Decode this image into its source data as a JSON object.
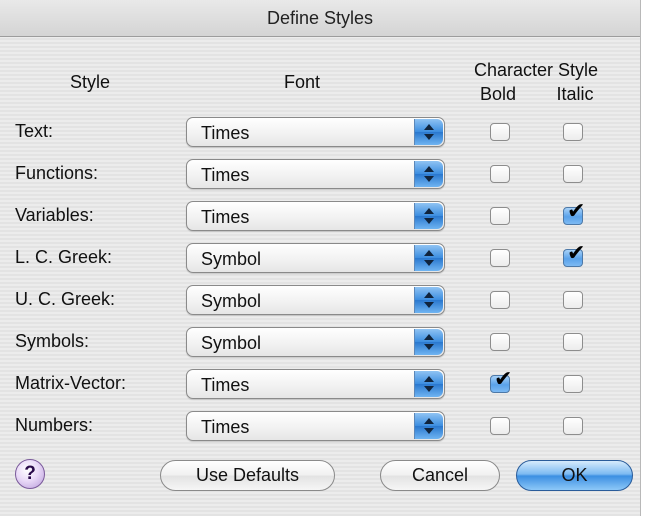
{
  "window": {
    "title": "Define Styles"
  },
  "headers": {
    "style": "Style",
    "font": "Font",
    "character_style": "Character Style",
    "bold": "Bold",
    "italic": "Italic"
  },
  "rows": [
    {
      "label": "Text:",
      "font": "Times",
      "bold": false,
      "italic": false
    },
    {
      "label": "Functions:",
      "font": "Times",
      "bold": false,
      "italic": false
    },
    {
      "label": "Variables:",
      "font": "Times",
      "bold": false,
      "italic": true
    },
    {
      "label": "L. C. Greek:",
      "font": "Symbol",
      "bold": false,
      "italic": true
    },
    {
      "label": "U. C. Greek:",
      "font": "Symbol",
      "bold": false,
      "italic": false
    },
    {
      "label": "Symbols:",
      "font": "Symbol",
      "bold": false,
      "italic": false
    },
    {
      "label": "Matrix-Vector:",
      "font": "Times",
      "bold": true,
      "italic": false
    },
    {
      "label": "Numbers:",
      "font": "Times",
      "bold": false,
      "italic": false
    }
  ],
  "buttons": {
    "help": "?",
    "use_defaults": "Use Defaults",
    "cancel": "Cancel",
    "ok": "OK"
  },
  "check_glyph": "✔"
}
